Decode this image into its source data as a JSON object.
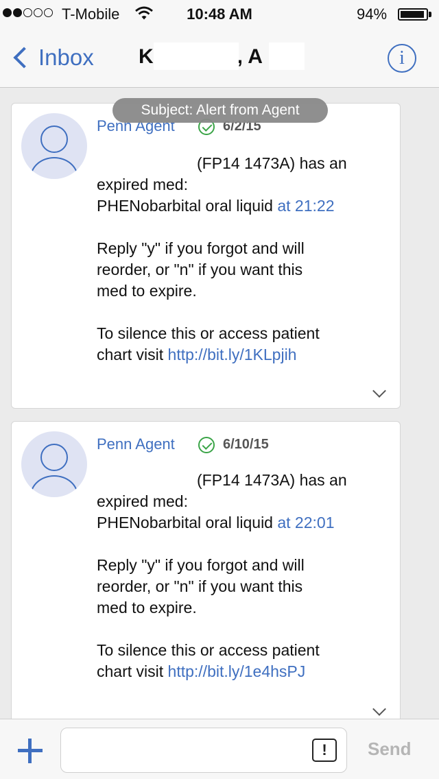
{
  "status_bar": {
    "carrier": "T-Mobile",
    "time": "10:48 AM",
    "battery": "94%",
    "battery_level": 0.94,
    "signal_bars": 2
  },
  "nav": {
    "back_label": "Inbox",
    "title_first": "K",
    "title_sep": ", A",
    "info_glyph": "i"
  },
  "subject": "Subject: Alert from Agent",
  "messages": [
    {
      "sender": "Penn Agent",
      "date": "6/2/15",
      "lines": [
        "(FP14 1473A) has an",
        "expired med:",
        "PHENobarbital oral liquid",
        "Reply \"y\" if you forgot and will",
        "reorder, or \"n\" if you want this",
        "med to expire.",
        "To silence this or access patient",
        "chart visit"
      ],
      "time_link": "at 21:22",
      "url": "http://bit.ly/1KLpjih"
    },
    {
      "sender": "Penn Agent",
      "date": "6/10/15",
      "lines": [
        "(FP14 1473A) has an",
        "expired med:",
        "PHENobarbital oral liquid",
        "Reply \"y\" if you forgot and will",
        "reorder, or \"n\" if you want this",
        "med to expire.",
        "To silence this or access patient",
        "chart visit"
      ],
      "time_link": "at 22:01",
      "url": "http://bit.ly/1e4hsPJ"
    }
  ],
  "compose": {
    "placeholder": "",
    "priority_glyph": "!",
    "send_label": "Send"
  },
  "icons": {
    "accent": "#3f6fc0",
    "verified": "#3aa447"
  }
}
